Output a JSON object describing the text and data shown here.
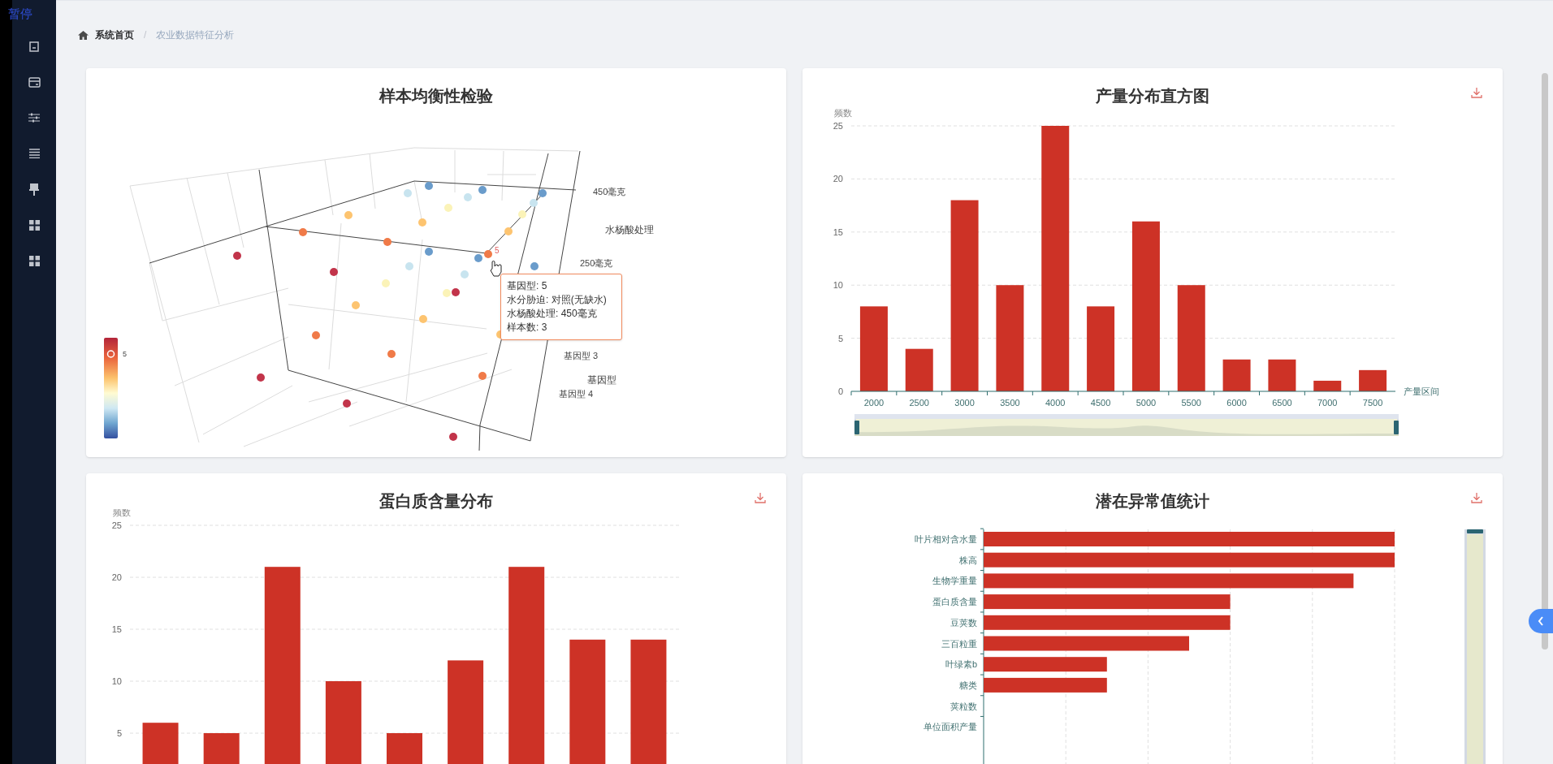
{
  "overlay_label": "暂停",
  "sidebar": {
    "items": [
      {
        "kind": "document"
      },
      {
        "kind": "card"
      },
      {
        "kind": "sliders"
      },
      {
        "kind": "list"
      },
      {
        "kind": "brush"
      },
      {
        "kind": "grid"
      },
      {
        "kind": "grid"
      }
    ]
  },
  "breadcrumb": {
    "separator": "/",
    "items": [
      "系统首页",
      "农业数据特征分析"
    ]
  },
  "panels": [
    {
      "kind": "scatter3d",
      "title": "样本均衡性检验",
      "axis_labels": {
        "z_top": "450毫克",
        "z_name": "水杨酸处理",
        "z_mid": "250毫克",
        "x_tick_a": "基因型 3",
        "x_name": "基因型",
        "x_tick_b": "基因型 4"
      },
      "visual_map_label": "5",
      "point_label": "5",
      "tooltip": [
        "基因型: 5",
        "水分胁迫: 对照(无缺水)",
        "水杨酸处理: 450毫克",
        "样本数: 3"
      ]
    },
    {
      "kind": "histogram",
      "title": "产量分布直方图",
      "download_button": true,
      "zoom_slider": {
        "level": 1
      },
      "chart_data": {
        "type": "bar",
        "grid": true,
        "xlabel": "产量区间",
        "ylabel": "频数",
        "categories": [
          "2000",
          "2500",
          "3000",
          "3500",
          "4000",
          "4500",
          "5000",
          "5500",
          "6000",
          "6500",
          "7000",
          "7500"
        ],
        "values": [
          8,
          4,
          18,
          10,
          25,
          8,
          16,
          10,
          3,
          3,
          1,
          2
        ],
        "ylim": [
          0,
          25
        ],
        "yticks": [
          0,
          5,
          10,
          15,
          20,
          25
        ]
      }
    },
    {
      "kind": "histogram",
      "title": "蛋白质含量分布",
      "download_button": true,
      "chart_data": {
        "type": "bar",
        "grid": true,
        "ylabel": "频数",
        "values": [
          6,
          5,
          21,
          10,
          5,
          12,
          21,
          14,
          14
        ],
        "ylim": [
          0,
          25
        ],
        "yticks": [
          5,
          10,
          15,
          20,
          25
        ]
      }
    },
    {
      "kind": "hbars",
      "title": "潜在异常值统计",
      "download_button": true,
      "zoom_slider": {
        "level": 1
      },
      "category_labels": [
        "叶片相对含水量",
        "株高",
        "生物学重量",
        "蛋白质含量",
        "豆荚数",
        "三百粒重",
        "叶绿素b",
        "糖类",
        "荚粒数",
        "单位面积产量"
      ]
    }
  ]
}
